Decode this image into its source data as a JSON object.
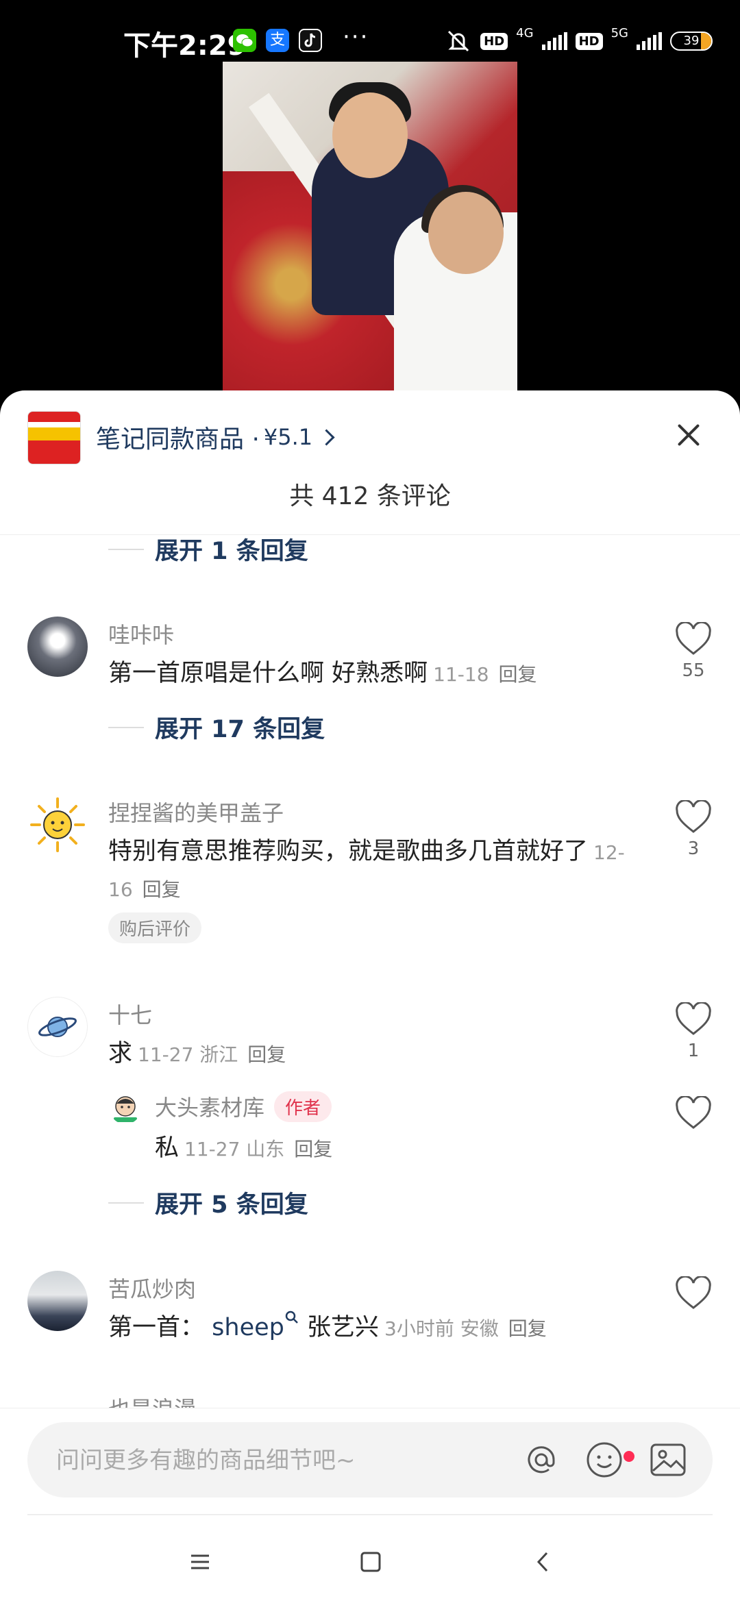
{
  "status_bar": {
    "time": "下午2:29",
    "alipay_glyph": "支",
    "more": "···",
    "hd1": "HD",
    "net1": "4G",
    "hd2": "HD",
    "net2": "5G",
    "battery": "39",
    "icons": [
      "wechat-icon",
      "alipay-icon",
      "tiktok-icon",
      "mute-bell-icon",
      "signal-icon",
      "battery-icon"
    ]
  },
  "sheet": {
    "product_link": "笔记同款商品 · ",
    "product_price": "¥5.1",
    "comment_count": "共 412 条评论"
  },
  "comments": [
    {
      "expand": "展开 1 条回复"
    },
    {
      "user": "哇咔咔",
      "text": "第一首原唱是什么啊 好熟悉啊",
      "meta": "11-18",
      "reply": "回复",
      "likes": "55",
      "expand": "展开 17 条回复"
    },
    {
      "user": "捏捏酱的美甲盖子",
      "text": "特别有意思推荐购买，就是歌曲多几首就好了",
      "meta": "12-16",
      "reply": "回复",
      "likes": "3",
      "tag": "购后评价"
    },
    {
      "user": "十七",
      "text": "求",
      "meta": "11-27 浙江",
      "reply": "回复",
      "likes": "1",
      "sub": {
        "user": "大头素材库",
        "author_tag": "作者",
        "text": "私",
        "meta": "11-27 山东",
        "reply": "回复"
      },
      "expand": "展开 5 条回复"
    },
    {
      "user": "苦瓜炒肉",
      "text_prefix": "第一首：",
      "song": "sheep",
      "text_suffix": " 张艺兴",
      "meta": "3小时前 安徽",
      "reply": "回复"
    },
    {
      "user": "也是浪漫"
    }
  ],
  "input": {
    "placeholder": "问问更多有趣的商品细节吧~"
  },
  "colors": {
    "link": "#1f3a5f",
    "author_tag": "#e0324c",
    "badge_dot": "#ff2d55"
  }
}
